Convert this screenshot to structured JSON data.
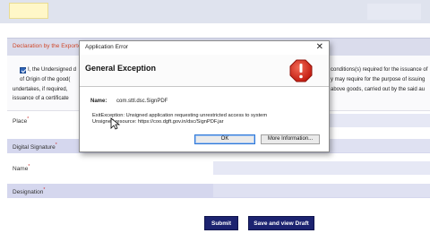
{
  "form": {
    "section_title": "Declaration by the Exporter",
    "declaration_lines": [
      "I, the Undersigned d",
      "of Origin of the good(",
      "undertakes, if required,",
      "issuance of a certificate"
    ],
    "declaration_right_lines": [
      "conditions(s) required for the issuance of",
      "y may require for the purpose of issuing",
      "above goods, carried out by the said au"
    ],
    "fields": [
      {
        "label": "Place",
        "required_mark": "*"
      },
      {
        "label": "Digital Signature",
        "required_mark": "*"
      },
      {
        "label": "Name",
        "required_mark": "*"
      },
      {
        "label": "Designation",
        "required_mark": "*"
      }
    ],
    "submit_label": "Submit",
    "save_draft_label": "Save and view Draft"
  },
  "dialog": {
    "title": "Application Error",
    "close_glyph": "✕",
    "heading": "General Exception",
    "name_label": "Name:",
    "name_value": "com.sttl.dsc.SignPDF",
    "message_line1": "ExitException: Unsigned application requesting unrestricted access to system",
    "message_line2": "Unsigned resource: https://coo.dgft.gov.in/dsc/SignPDF.jar",
    "ok_label": "OK",
    "more_label": "More Information...",
    "icon": "error-exclamation-icon",
    "icon_color": "#d42a1f"
  }
}
